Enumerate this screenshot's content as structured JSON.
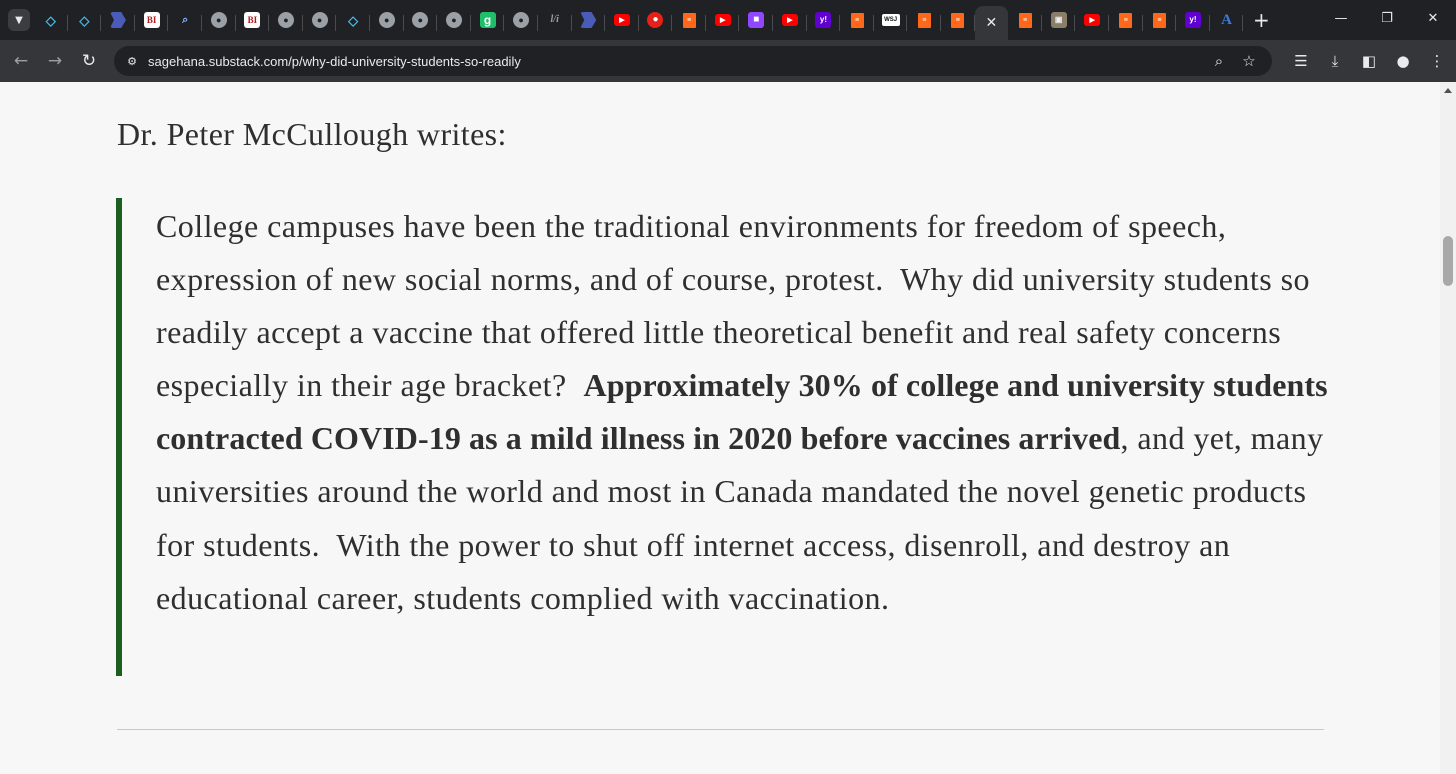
{
  "browser": {
    "tab_search_icon": "chevron-down-icon",
    "tabs": [
      {
        "icon": "shield-icon",
        "glyph": "◇",
        "style": "shield"
      },
      {
        "icon": "shield-icon",
        "glyph": "◇",
        "style": "shield"
      },
      {
        "icon": "arrow-icon",
        "glyph": "",
        "style": "arrow"
      },
      {
        "icon": "bi-icon",
        "glyph": "BI",
        "style": "bi"
      },
      {
        "icon": "magnifier-icon",
        "glyph": "⌕",
        "style": "mag"
      },
      {
        "icon": "globe-icon",
        "glyph": "●",
        "style": "globe"
      },
      {
        "icon": "bi-icon",
        "glyph": "BI",
        "style": "bi"
      },
      {
        "icon": "globe-icon",
        "glyph": "●",
        "style": "globe"
      },
      {
        "icon": "globe-icon",
        "glyph": "●",
        "style": "globe"
      },
      {
        "icon": "shield-icon",
        "glyph": "◇",
        "style": "shield"
      },
      {
        "icon": "globe-icon",
        "glyph": "●",
        "style": "globe"
      },
      {
        "icon": "globe-icon",
        "glyph": "●",
        "style": "globe"
      },
      {
        "icon": "globe-icon",
        "glyph": "●",
        "style": "globe"
      },
      {
        "icon": "g-icon",
        "glyph": "g",
        "style": "g"
      },
      {
        "icon": "globe-icon",
        "glyph": "●",
        "style": "globe"
      },
      {
        "icon": "italic-icon",
        "glyph": "l/i",
        "style": "ab"
      },
      {
        "icon": "arrow-icon",
        "glyph": "",
        "style": "arrow"
      },
      {
        "icon": "youtube-icon",
        "glyph": "▶",
        "style": "yt"
      },
      {
        "icon": "microphone-icon",
        "glyph": "●",
        "style": "mic"
      },
      {
        "icon": "substack-icon",
        "glyph": "≡",
        "style": "ss"
      },
      {
        "icon": "youtube-icon",
        "glyph": "▶",
        "style": "yt"
      },
      {
        "icon": "twitch-icon",
        "glyph": "■",
        "style": "tw"
      },
      {
        "icon": "youtube-icon",
        "glyph": "▶",
        "style": "yt"
      },
      {
        "icon": "yahoo-icon",
        "glyph": "y!",
        "style": "yh"
      },
      {
        "icon": "substack-icon",
        "glyph": "≡",
        "style": "ss"
      },
      {
        "icon": "wsj-icon",
        "glyph": "WSJ",
        "style": "wsj"
      },
      {
        "icon": "substack-icon",
        "glyph": "≡",
        "style": "ss"
      },
      {
        "icon": "substack-icon",
        "glyph": "≡",
        "style": "ss"
      },
      {
        "icon": "close-icon",
        "glyph": "✕",
        "style": "active"
      },
      {
        "icon": "substack-icon",
        "glyph": "≡",
        "style": "ss"
      },
      {
        "icon": "photo-icon",
        "glyph": "▣",
        "style": "photo"
      },
      {
        "icon": "youtube-icon",
        "glyph": "▶",
        "style": "yt"
      },
      {
        "icon": "substack-icon",
        "glyph": "≡",
        "style": "ss"
      },
      {
        "icon": "substack-icon",
        "glyph": "≡",
        "style": "ss"
      },
      {
        "icon": "yahoo-icon",
        "glyph": "y!",
        "style": "yh"
      },
      {
        "icon": "letter-a-icon",
        "glyph": "A",
        "style": "A"
      }
    ],
    "new_tab_glyph": "+",
    "window_controls": {
      "minimize": "—",
      "restore": "❐",
      "close": "✕"
    },
    "address_bar": {
      "url": "sagehana.substack.com/p/why-did-university-students-so-readily"
    },
    "nav_glyphs": {
      "back": "←",
      "forward": "→",
      "reload": "↻"
    },
    "omnibox_icons": {
      "zoom": "⌕",
      "bookmark": "☆"
    },
    "toolbar_icons": {
      "reading_list": "☰",
      "downloads": "⤓",
      "side_panel": "◧",
      "profile": "●",
      "menu": "⋮"
    }
  },
  "article": {
    "lead": "Dr. Peter McCullough writes:",
    "quote_before": "College campuses have been the traditional environments for freedom of speech, expression of new social norms, and of course, protest.  Why did university students so readily accept a vaccine that offered little theoretical benefit and real safety concerns especially in their age bracket?  ",
    "quote_bold": "Approximately 30% of college and university students contracted COVID-19 as a mild illness in 2020 before vaccines arrived",
    "quote_after": ", and yet, many universities around the world and most in Canada mandated the novel genetic products for students.  With the power to shut off internet access, disenroll, and destroy an educational career, students complied with vaccination.",
    "quote_border_color": "#1c5e1f"
  }
}
